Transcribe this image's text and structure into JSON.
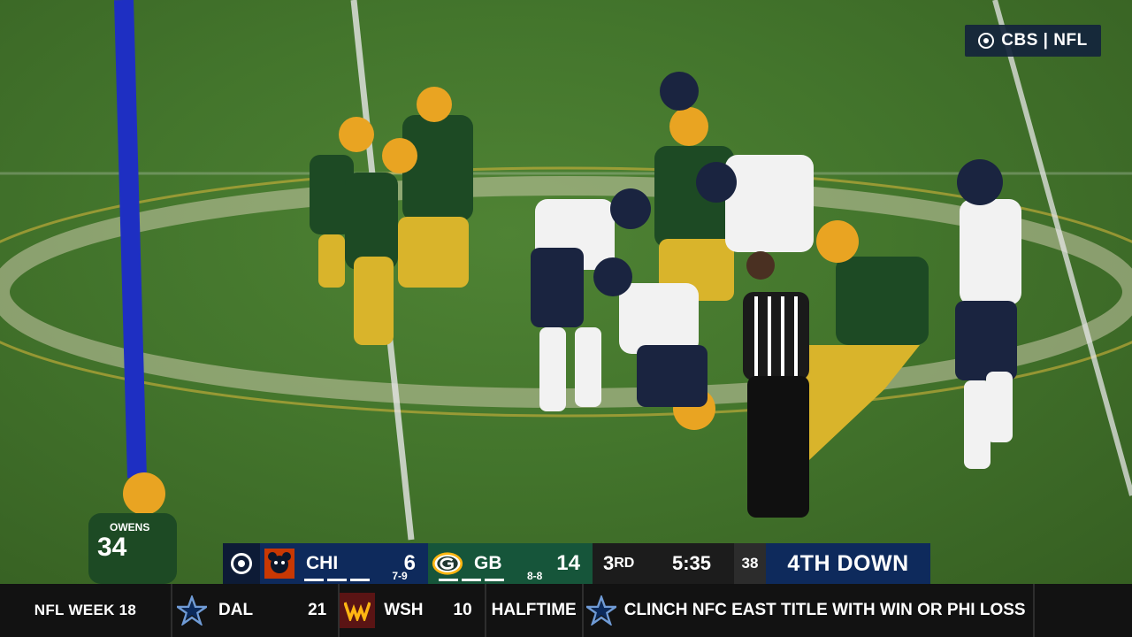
{
  "network_bug": {
    "label": "CBS | NFL"
  },
  "scorebug": {
    "away": {
      "abbr": "CHI",
      "score": "6",
      "record": "7-9",
      "logo": "bears-logo",
      "color": "#0e2a5c"
    },
    "home": {
      "abbr": "GB",
      "score": "14",
      "record": "8-8",
      "logo": "packers-logo",
      "color": "#16553a"
    },
    "quarter_num": "3",
    "quarter_suffix": "RD",
    "clock": "5:35",
    "play_clock": "38",
    "down_text": "4TH DOWN"
  },
  "ticker": {
    "title": "NFL WEEK 18",
    "game": {
      "away_abbr": "DAL",
      "away_score": "21",
      "away_logo": "cowboys-star-icon",
      "home_abbr": "WSH",
      "home_score": "10",
      "home_logo": "commanders-logo",
      "status": "HALFTIME"
    },
    "note_logo": "cowboys-star-icon",
    "note": "CLINCH NFC EAST TITLE WITH WIN OR PHI LOSS"
  },
  "jersey_numbers": {
    "owens_name": "OWENS",
    "owens_number": "34"
  }
}
